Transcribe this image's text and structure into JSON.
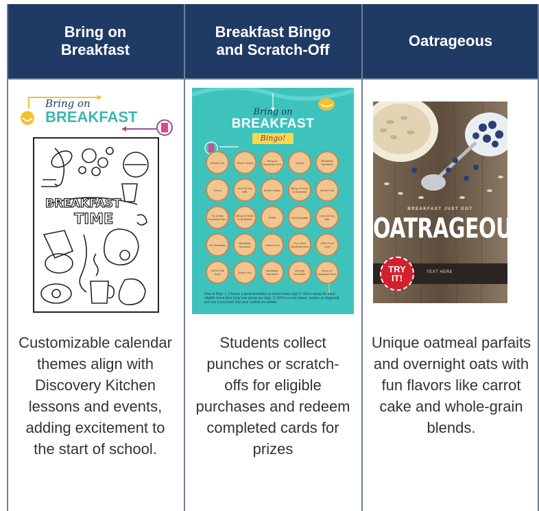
{
  "columns": [
    {
      "header": "Bring on Breakfast",
      "header_line1": "Bring on",
      "header_line2": "Breakfast",
      "description": "Customizable calendar themes align with Discovery Kitchen lessons and events, adding excitement to the start of school."
    },
    {
      "header": "Breakfast Bingo and Scratch-Off",
      "header_line1": "Breakfast Bingo",
      "header_line2": "and Scratch-Off",
      "description": "Students collect punches or scratch-offs for eligible purchases and redeem completed cards for prizes"
    },
    {
      "header": "Oatrageous",
      "description": "Unique oatmeal parfaits and overnight oats with fun flavors like carrot cake and whole-grain blends."
    }
  ],
  "poster1": {
    "logo_line1": "Bring on",
    "logo_line2": "BREAKFAST"
  },
  "poster2": {
    "title_line1": "Bring on",
    "title_line2": "BREAKFAST",
    "badge": "Bingo!",
    "cells": [
      "Whole Fruit",
      "Whole Grains",
      "Bring on Breakfast Item",
      "Cereal",
      "Breakfast Sandwich",
      "Cereal",
      "Low Fat Soy Milk",
      "Whole Grains",
      "Bring a Friend to Breakfast",
      "Whole Fruit",
      "Try a New Breakfast Item",
      "Bring a Friend to Breakfast",
      "FREE",
      "Full Breakfast",
      "Low Fat Soy Milk",
      "Full Breakfast",
      "Breakfast Sandwich",
      "Chilled Fruit",
      "Try a New Breakfast Item",
      "100% Fruit Juice",
      "100% Fruit Juice",
      "Dried Fruit",
      "Breakfast Sandwich",
      "Monday Breakfast",
      "Bring on Breakfast Item"
    ],
    "how_to": "How to Play: 1. Choose a great breakfast at school every day! 2. Get a stamp for each eligible menu item (only one stamp per day). 3. Fill 5 in a row (down, across, or diagonal) and win a fun prize! See your cashier for details."
  },
  "poster3": {
    "tagline": "BREAKFAST JUST GOT",
    "headline": "OATRAGEOUS!",
    "badge_line1": "TRY",
    "badge_line2": "IT!",
    "placeholder": "TEXT HERE"
  },
  "colors": {
    "header_bg": "#1f3a64",
    "bingo_bg": "#3ec2bc",
    "logo_teal": "#3ab7b4",
    "try_red": "#d3202f"
  }
}
